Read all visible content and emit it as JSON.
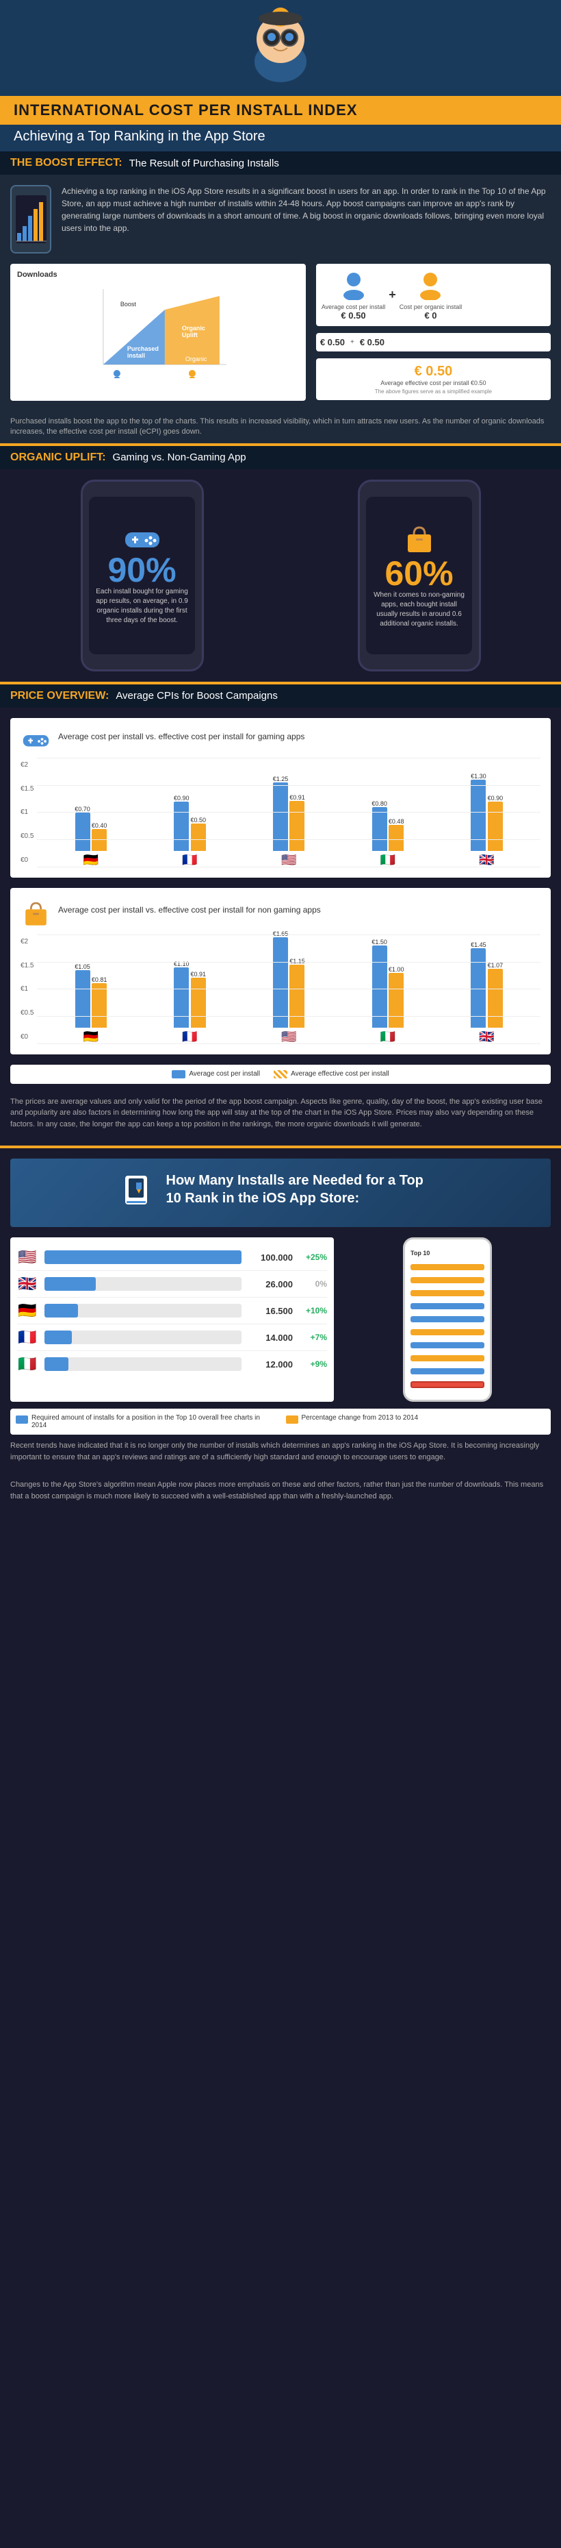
{
  "header": {
    "title": "INTERNATIONAL COST PER INSTALL INDEX",
    "subtitle": "Achieving a Top Ranking in the App Store",
    "mascot_alt": "GM mascot character"
  },
  "boost_section": {
    "label": "THE BOOST EFFECT:",
    "description": "The Result of Purchasing Installs",
    "intro_text": "Achieving a top ranking in the iOS App Store results in a significant boost in users for an app. In order to rank in the Top 10 of the App Store, an app must achieve a high number of installs within 24-48 hours. App boost campaigns can improve an app's rank by generating large numbers of downloads in a short amount of time. A big boost in organic downloads follows, bringing even more loyal users into the app.",
    "chart_label": "Downloads",
    "boost_label": "Boost",
    "organic_label": "Organic Uplift",
    "purchased_label": "Purchased install",
    "organic_install_label": "Organic install",
    "formula": {
      "avg_cost_label": "Average cost per install",
      "cost_organic_label": "Cost per organic install",
      "avg_cost_value": "€ 0.50",
      "cost_organic_value": "€ 0",
      "sum_value": "€ 0.50",
      "effective_label": "Average effective cost per install €0.50",
      "note": "The above figures serve as a simplified example"
    },
    "footnote": "Purchased installs boost the app to the top of the charts. This results in increased visibility, which in turn attracts new users. As the number of organic downloads increases, the effective cost per install (eCPI) goes down."
  },
  "organic_section": {
    "label": "ORGANIC UPLIFT:",
    "description": "Gaming vs. Non-Gaming App",
    "gaming_percent": "90%",
    "gaming_text": "Each install bought for gaming app results, on average, in 0.9 organic installs during the first three days of the boost.",
    "nongaming_percent": "60%",
    "nongaming_text": "When it comes to non-gaming apps, each bought install usually results in around 0.6 additional organic installs."
  },
  "price_section": {
    "label": "PRICE OVERVIEW:",
    "description": "Average CPIs for Boost Campaigns",
    "gaming_chart_title": "Average cost per install vs. effective cost per install for gaming apps",
    "nongaming_chart_title": "Average cost per install vs. effective cost per install for non gaming apps",
    "gaming_data": [
      {
        "country": "🇩🇪",
        "avg": 0.7,
        "eff": 0.4,
        "avg_label": "€0.70",
        "eff_label": "€0.40"
      },
      {
        "country": "🇫🇷",
        "avg": 0.9,
        "eff": 0.5,
        "avg_label": "€0.90",
        "eff_label": "€0.50"
      },
      {
        "country": "🇺🇸",
        "avg": 1.25,
        "eff": 0.91,
        "avg_label": "€1.25",
        "eff_label": "€0.91"
      },
      {
        "country": "🇮🇹",
        "avg": 0.8,
        "eff": 0.48,
        "avg_label": "€0.80",
        "eff_label": "€0.48"
      },
      {
        "country": "🇬🇧",
        "avg": 1.3,
        "eff": 0.9,
        "avg_label": "€1.30",
        "eff_label": "€0.90"
      }
    ],
    "nongaming_data": [
      {
        "country": "🇩🇪",
        "avg": 1.05,
        "eff": 0.81,
        "avg_label": "€1.05",
        "eff_label": "€0.81"
      },
      {
        "country": "🇫🇷",
        "avg": 1.1,
        "eff": 0.91,
        "avg_label": "€1.10",
        "eff_label": "€0.91"
      },
      {
        "country": "🇺🇸",
        "avg": 1.65,
        "eff": 1.15,
        "avg_label": "€1.65",
        "eff_label": "€1.15"
      },
      {
        "country": "🇮🇹",
        "avg": 1.5,
        "eff": 1.0,
        "avg_label": "€1.50",
        "eff_label": "€1.00"
      },
      {
        "country": "🇬🇧",
        "avg": 1.45,
        "eff": 1.07,
        "avg_label": "€1.45",
        "eff_label": "€1.07"
      }
    ],
    "legend_avg": "Average cost per install",
    "legend_eff": "Average effective cost per install",
    "y_labels_gaming": [
      "€2",
      "€1.5",
      "€1",
      "€0.5",
      "€0"
    ],
    "y_labels_nongaming": [
      "€2",
      "€1.5",
      "€1",
      "€0.5",
      "€0"
    ],
    "note": "The prices are average values and only valid for the period of the app boost campaign. Aspects like genre, quality, day of the boost, the app's existing user base and popularity are also factors in determining how long the app will stay at the top of the chart in the iOS App Store. Prices may also vary depending on these factors. In any case, the longer the app can keep a top position in the rankings, the more organic downloads it will generate."
  },
  "installs_section": {
    "title": "How Many Installs are Needed for a Top 10 Rank in the iOS App Store:",
    "countries": [
      {
        "flag": "🇺🇸",
        "number": "100.000",
        "pct": "+25%",
        "pct_type": "green",
        "bar_pct": 100
      },
      {
        "flag": "🇬🇧",
        "number": "26.000",
        "pct": "0%",
        "pct_type": "neutral",
        "bar_pct": 26
      },
      {
        "flag": "🇩🇪",
        "number": "16.500",
        "pct": "+10%",
        "pct_type": "green",
        "bar_pct": 17
      },
      {
        "flag": "🇫🇷",
        "number": "14.000",
        "pct": "+7%",
        "pct_type": "green",
        "bar_pct": 14
      },
      {
        "flag": "🇮🇹",
        "number": "12.000",
        "pct": "+9%",
        "pct_type": "green",
        "bar_pct": 12
      }
    ],
    "legend_installs": "Required amount of installs for a position in the Top 10 overall free charts in 2014",
    "legend_pct": "Percentage change from 2013 to 2014",
    "footnote1": "Recent trends have indicated that it is no longer only the number of installs which determines an app's ranking in the iOS App Store. It is becoming increasingly important to ensure that an app's reviews and ratings are of a sufficiently high standard and enough to encourage users to engage.",
    "footnote2": "Changes to the App Store's algorithm mean Apple now places more emphasis on these and other factors, rather than just the number of downloads. This means that a boost campaign is much more likely to succeed with a well-established app than with a freshly-launched app."
  }
}
